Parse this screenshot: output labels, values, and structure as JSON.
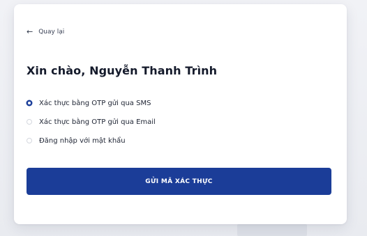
{
  "login": {
    "back_label": "Quay lại",
    "back_icon": "arrow-left-icon",
    "greeting": "Xin chào, Nguyễn Thanh Trình",
    "options": [
      {
        "label": "Xác thực bằng OTP gửi qua SMS",
        "selected": true
      },
      {
        "label": "Xác thực bằng OTP gửi qua Email",
        "selected": false
      },
      {
        "label": "Đăng nhập với mật khẩu",
        "selected": false
      }
    ],
    "submit_label": "GỬI MÃ XÁC THỰC"
  },
  "colors": {
    "primary": "#1b3d98",
    "title_text": "#141a2b",
    "card_bg": "#ffffff",
    "page_bg": "#eef0f4"
  }
}
